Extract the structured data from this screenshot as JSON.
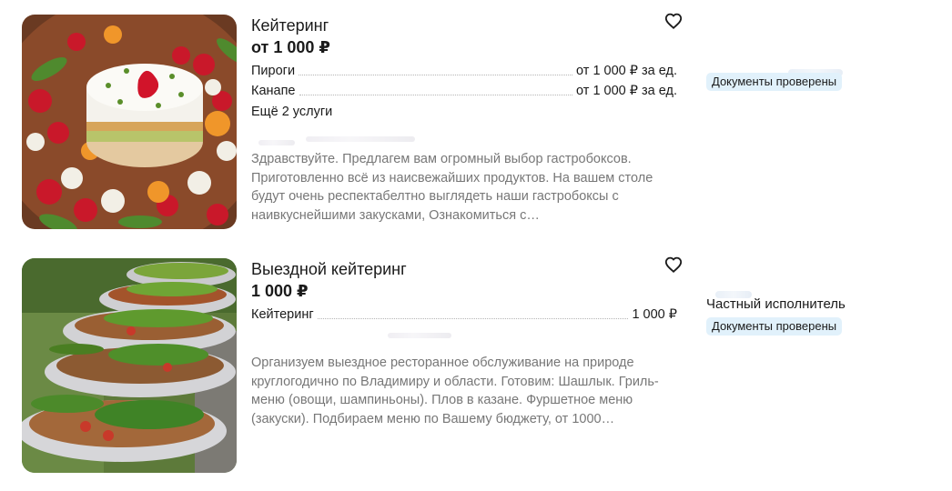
{
  "listings": [
    {
      "title": "Кейтеринг",
      "price": "от 1 000 ₽",
      "services": [
        {
          "name": "Пироги",
          "price": "от 1 000 ₽ за ед."
        },
        {
          "name": "Канапе",
          "price": "от 1 000 ₽ за ед."
        }
      ],
      "more_services": "Ещё 2 услуги",
      "description": "Здравствуйте. Предлагем вам огромный выбор гастробоксов. Приготовленно всё из наисвежайших продуктов. На вашем столе будут очень респектабелтно выглядеть наши гастробоксы с наивкуснейшими закусками, Ознакомиться с…",
      "badge": "Документы проверены",
      "favorite_icon": "heart-outline-icon"
    },
    {
      "title": "Выездной кейтеринг",
      "price": "1 000 ₽",
      "services": [
        {
          "name": "Кейтеринг",
          "price": "1 000 ₽"
        }
      ],
      "description": "Организуем выездное ресторанное обслуживание на природе круглогодично по Владимиру и области. Готовим: Шашлык. Гриль-меню (овощи, шампиньоны). Плов в казане. Фуршетное меню (закуски). Подбираем меню по Вашему бюджету, от 1000…",
      "seller_type": "Частный исполнитель",
      "badge": "Документы проверены",
      "favorite_icon": "heart-outline-icon"
    }
  ]
}
